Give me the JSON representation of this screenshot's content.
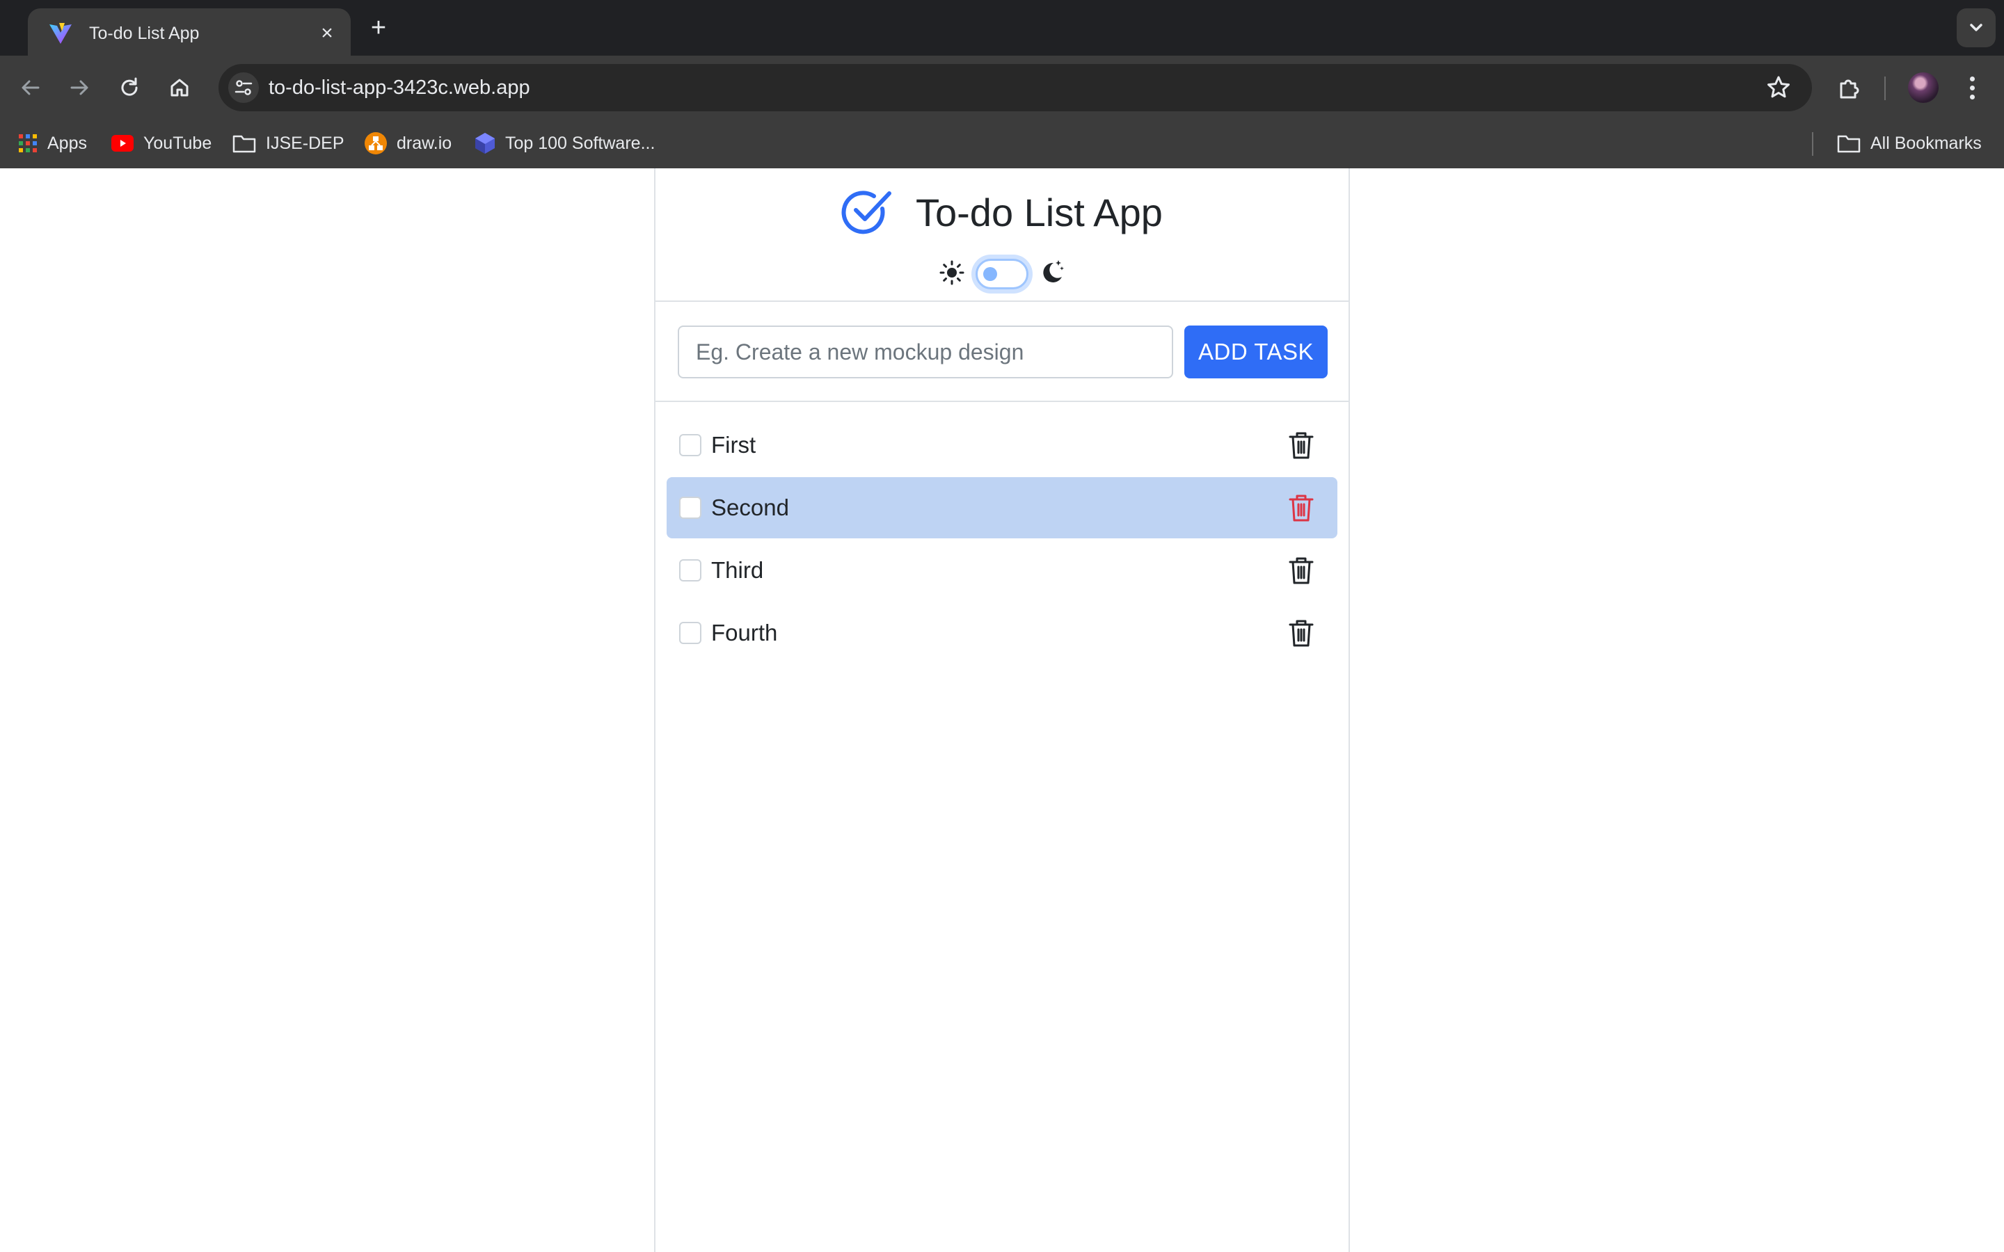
{
  "browser": {
    "tab_title": "To-do List App",
    "url": "to-do-list-app-3423c.web.app",
    "bookmarks": [
      {
        "label": "Apps",
        "icon": "apps-grid-icon"
      },
      {
        "label": "YouTube",
        "icon": "youtube-icon"
      },
      {
        "label": "IJSE-DEP",
        "icon": "folder-icon"
      },
      {
        "label": "draw.io",
        "icon": "drawio-icon"
      },
      {
        "label": "Top 100 Software...",
        "icon": "cube-icon"
      }
    ],
    "all_bookmarks": "All Bookmarks"
  },
  "app": {
    "title": "To-do List App",
    "accent_color": "#2f6df6",
    "theme_toggle": {
      "left_icon": "sun-icon",
      "right_icon": "moon-icon",
      "dark_mode": false
    },
    "input": {
      "placeholder": "Eg. Create a new mockup design",
      "value": ""
    },
    "add_button": "ADD TASK",
    "tasks": [
      {
        "label": "First",
        "done": false,
        "highlighted": false
      },
      {
        "label": "Second",
        "done": false,
        "highlighted": true
      },
      {
        "label": "Third",
        "done": false,
        "highlighted": false
      },
      {
        "label": "Fourth",
        "done": false,
        "highlighted": false
      }
    ]
  }
}
